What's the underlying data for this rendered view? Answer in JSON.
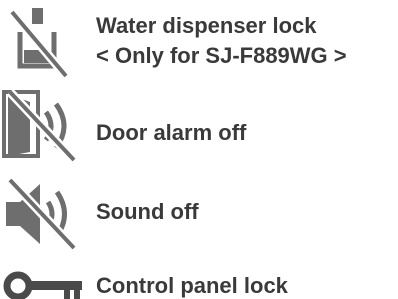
{
  "colors": {
    "text": "#3a3a3a",
    "icon_fill": "#6e6e6e",
    "icon_dark": "#4a4a4a",
    "background": "#ffffff"
  },
  "items": [
    {
      "icon": "water-dispenser-lock-icon",
      "label": "Water dispenser lock",
      "sublabel": "< Only for SJ-F889WG >"
    },
    {
      "icon": "door-alarm-off-icon",
      "label": "Door alarm off"
    },
    {
      "icon": "sound-off-icon",
      "label": "Sound off"
    },
    {
      "icon": "key-icon",
      "label": "Control panel lock"
    }
  ]
}
